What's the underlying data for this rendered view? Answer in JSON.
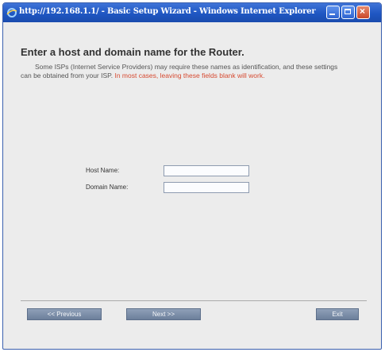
{
  "window": {
    "title": "http://192.168.1.1/ - Basic Setup Wizard - Windows Internet Explorer"
  },
  "page": {
    "heading": "Enter a host and domain name for the Router.",
    "description": "Some ISPs (Internet Service Providers) may require these names as identification, and these settings can be obtained from your ISP.",
    "note": "In most cases, leaving these fields blank will work."
  },
  "form": {
    "host_name": {
      "label": "Host Name:",
      "value": ""
    },
    "domain_name": {
      "label": "Domain Name:",
      "value": ""
    }
  },
  "buttons": {
    "previous": "<< Previous",
    "next": "Next >>",
    "exit": "Exit"
  },
  "colors": {
    "titlebar": "#1f56c2",
    "note_red": "#d64a31",
    "button": "#7a8ba5"
  },
  "icons": {
    "browser": "ie-logo-icon",
    "minimize": "minimize-icon",
    "maximize": "maximize-icon",
    "close": "close-icon"
  }
}
